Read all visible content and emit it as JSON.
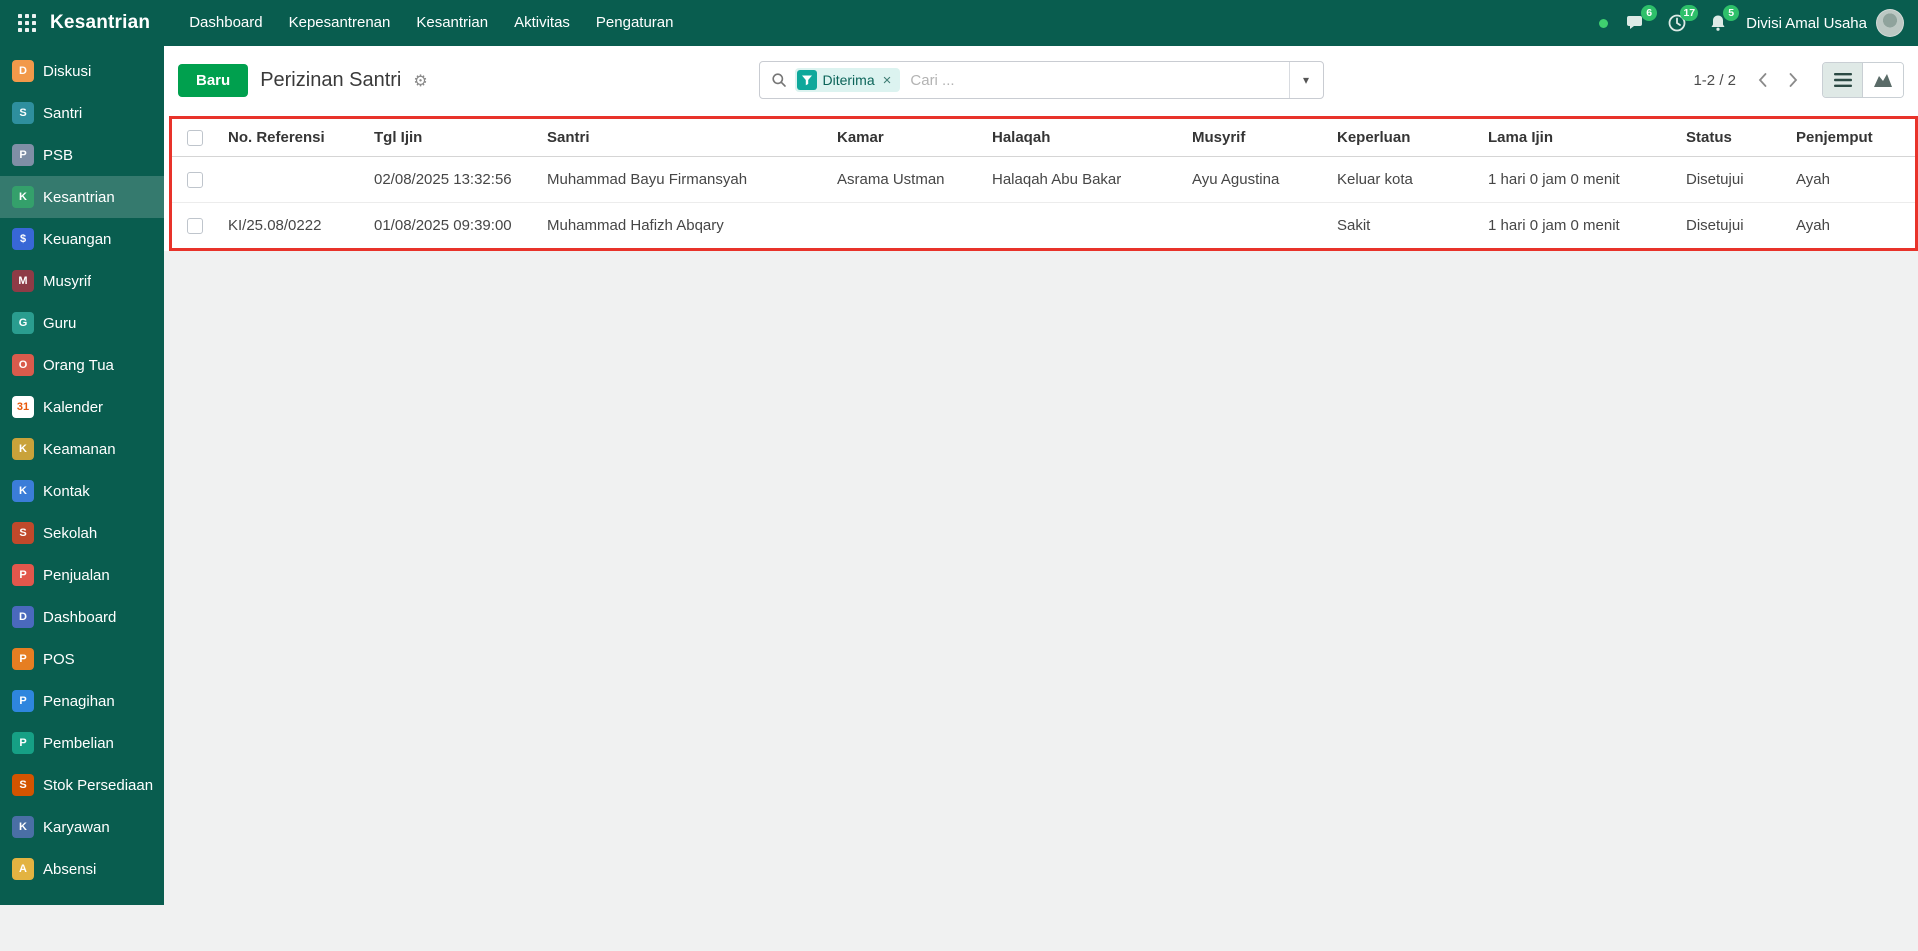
{
  "navbar": {
    "brand": "Kesantrian",
    "menus": [
      "Dashboard",
      "Kepesantrenan",
      "Kesantrian",
      "Aktivitas",
      "Pengaturan"
    ],
    "badges": {
      "messages": "6",
      "activities": "17",
      "notifications": "5"
    },
    "user": "Divisi Amal Usaha"
  },
  "sidebar": {
    "items": [
      {
        "label": "Diskusi",
        "icon_bg": "#f2994a",
        "glyph": "D"
      },
      {
        "label": "Santri",
        "icon_bg": "#2e8f9e",
        "glyph": "S"
      },
      {
        "label": "PSB",
        "icon_bg": "#7f8fa6",
        "glyph": "P"
      },
      {
        "label": "Kesantrian",
        "icon_bg": "#34a06b",
        "glyph": "K",
        "active": true
      },
      {
        "label": "Keuangan",
        "icon_bg": "#3867d6",
        "glyph": "$"
      },
      {
        "label": "Musyrif",
        "icon_bg": "#8e3b46",
        "glyph": "M"
      },
      {
        "label": "Guru",
        "icon_bg": "#2a9d8f",
        "glyph": "G"
      },
      {
        "label": "Orang Tua",
        "icon_bg": "#d95b4c",
        "glyph": "O"
      },
      {
        "label": "Kalender",
        "icon_bg": "#ffffff",
        "icon_fg": "#e8590c",
        "glyph": "31"
      },
      {
        "label": "Keamanan",
        "icon_bg": "#c9a23a",
        "glyph": "K"
      },
      {
        "label": "Kontak",
        "icon_bg": "#3b7dd8",
        "glyph": "K"
      },
      {
        "label": "Sekolah",
        "icon_bg": "#c0492b",
        "glyph": "S"
      },
      {
        "label": "Penjualan",
        "icon_bg": "#e2574c",
        "glyph": "P"
      },
      {
        "label": "Dashboard",
        "icon_bg": "#4a69bd",
        "glyph": "D"
      },
      {
        "label": "POS",
        "icon_bg": "#e67e22",
        "glyph": "P"
      },
      {
        "label": "Penagihan",
        "icon_bg": "#2e86de",
        "glyph": "P"
      },
      {
        "label": "Pembelian",
        "icon_bg": "#16a085",
        "glyph": "P"
      },
      {
        "label": "Stok Persediaan",
        "icon_bg": "#d35400",
        "glyph": "S"
      },
      {
        "label": "Karyawan",
        "icon_bg": "#4a6fa5",
        "glyph": "K"
      },
      {
        "label": "Absensi",
        "icon_bg": "#e3b341",
        "glyph": "A"
      }
    ]
  },
  "control": {
    "new_button": "Baru",
    "title": "Perizinan Santri",
    "filter_chip": "Diterima",
    "search_placeholder": "Cari ...",
    "pager": "1-2 / 2"
  },
  "table": {
    "columns": [
      "No. Referensi",
      "Tgl Ijin",
      "Santri",
      "Kamar",
      "Halaqah",
      "Musyrif",
      "Keperluan",
      "Lama Ijin",
      "Status",
      "Penjemput"
    ],
    "row_keys": [
      "no_referensi",
      "tgl_ijin",
      "santri",
      "kamar",
      "halaqah",
      "musyrif",
      "keperluan",
      "lama_ijin",
      "status",
      "penjemput"
    ],
    "rows": [
      {
        "no_referensi": "",
        "tgl_ijin": "02/08/2025 13:32:56",
        "santri": "Muhammad Bayu Firmansyah",
        "kamar": "Asrama Ustman",
        "halaqah": "Halaqah Abu Bakar",
        "musyrif": "Ayu Agustina",
        "keperluan": "Keluar kota",
        "lama_ijin": "1 hari 0 jam 0 menit",
        "status": "Disetujui",
        "penjemput": "Ayah"
      },
      {
        "no_referensi": "KI/25.08/0222",
        "tgl_ijin": "01/08/2025 09:39:00",
        "santri": "Muhammad Hafizh Abqary",
        "kamar": "",
        "halaqah": "",
        "musyrif": "",
        "keperluan": "Sakit",
        "lama_ijin": "1 hari 0 jam 0 menit",
        "status": "Disetujui",
        "penjemput": "Ayah"
      }
    ]
  },
  "colors": {
    "navbar_bg": "#095d4f",
    "sidebar_active": "#2e7a6b",
    "primary_button": "#00a04e",
    "filter_accent": "#0ea89b",
    "badge_green": "#2ec06a",
    "annotation_red": "#e8332a"
  }
}
